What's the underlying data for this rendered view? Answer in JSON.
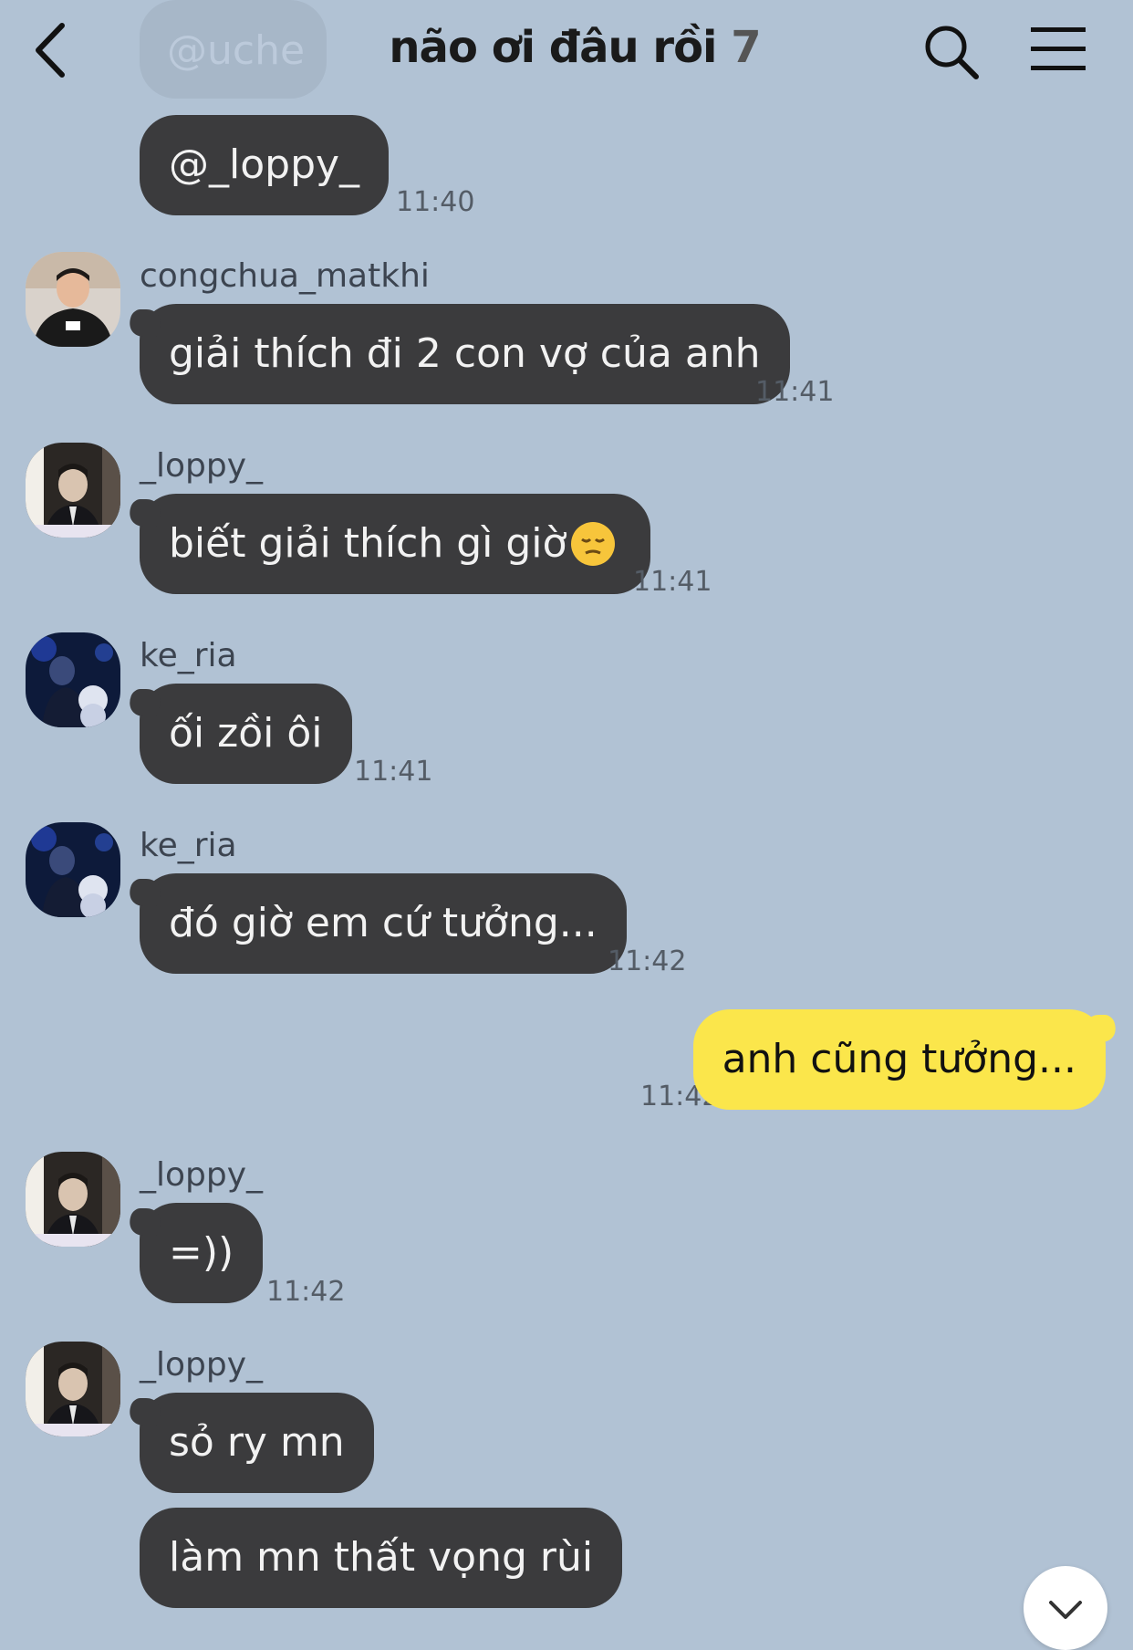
{
  "header": {
    "title": "não ơi đâu rồi",
    "member_count": "7",
    "back_icon": "back-arrow-icon",
    "search_icon": "search-icon",
    "menu_icon": "hamburger-menu-icon"
  },
  "colors": {
    "background": "#b1c2d4",
    "bubble_other": "#3b3b3d",
    "bubble_mine": "#fbe64b"
  },
  "messages": [
    {
      "text": "@uche",
      "faded": true
    },
    {
      "text": "@_loppy_",
      "time": "11:40"
    },
    {
      "sender": "congchua_matkhi",
      "text": "giải thích đi 2 con vợ của anh",
      "time": "11:41"
    },
    {
      "sender": "_loppy_",
      "text": "biết giải thích gì giờ",
      "emoji": "pensive-face-icon",
      "time": "11:41"
    },
    {
      "sender": "ke_ria",
      "text": "ối zồi ôi",
      "time": "11:41"
    },
    {
      "sender": "ke_ria",
      "text": "đó giờ em cứ tưởng...",
      "time": "11:42"
    },
    {
      "sender": "me",
      "text": "anh cũng tưởng...",
      "time": "11:42"
    },
    {
      "sender": "_loppy_",
      "text": "=))",
      "time": "11:42"
    },
    {
      "sender": "_loppy_",
      "text": "sỏ ry mn"
    },
    {
      "text": "làm mn thất vọng rùi"
    }
  ],
  "scroll_down_icon": "chevron-down-icon"
}
